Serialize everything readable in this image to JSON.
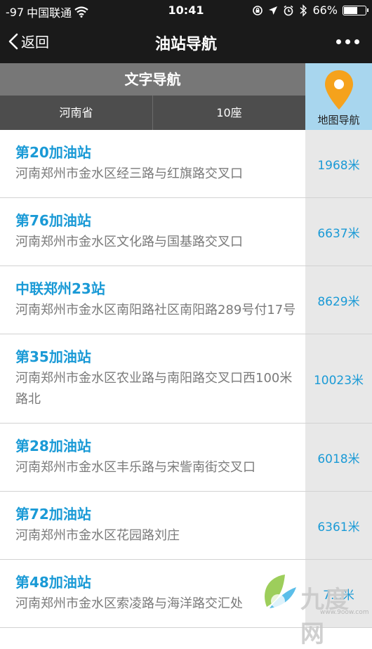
{
  "status_bar": {
    "signal": "-97",
    "carrier": "中国联通",
    "time": "10:41",
    "battery": "66%",
    "battery_level": 0.66
  },
  "nav": {
    "back_label": "返回",
    "title": "油站导航"
  },
  "header": {
    "text_nav": "文字导航",
    "province": "河南省",
    "seats": "10座",
    "map_nav": "地图导航"
  },
  "stations": [
    {
      "name": "第20加油站",
      "address": "河南郑州市金水区经三路与红旗路交叉口",
      "distance": "1968米"
    },
    {
      "name": "第76加油站",
      "address": "河南郑州市金水区文化路与国基路交叉口",
      "distance": "6637米"
    },
    {
      "name": "中联郑州23站",
      "address": "河南郑州市金水区南阳路社区南阳路289号付17号",
      "distance": "8629米"
    },
    {
      "name": "第35加油站",
      "address": "河南郑州市金水区农业路与南阳路交叉口西100米路北",
      "distance": "10023米"
    },
    {
      "name": "第28加油站",
      "address": "河南郑州市金水区丰乐路与宋訾南街交叉口",
      "distance": "6018米"
    },
    {
      "name": "第72加油站",
      "address": "河南郑州市金水区花园路刘庄",
      "distance": "6361米"
    },
    {
      "name": "第48加油站",
      "address": "河南郑州市金水区索凌路与海洋路交汇处",
      "distance": "7…米"
    }
  ],
  "watermark": {
    "text": "九度网",
    "url": "www.9oow.com"
  },
  "colors": {
    "accent": "#1a9ad6",
    "bar": "#1a1a1a",
    "pin": "#f5a21c"
  }
}
